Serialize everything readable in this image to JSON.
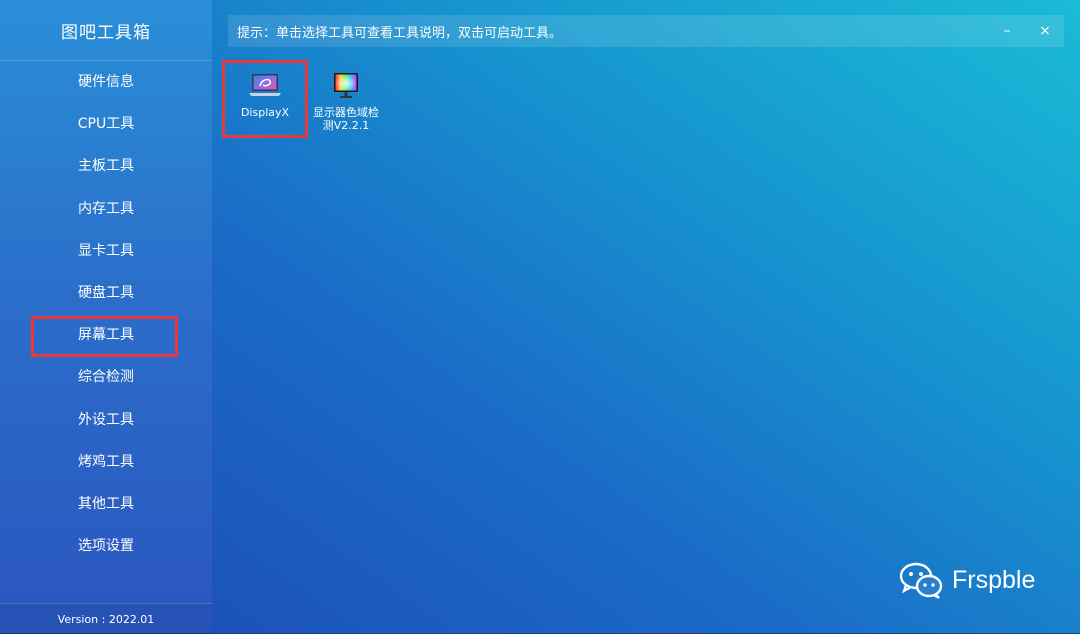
{
  "app": {
    "title": "图吧工具箱",
    "version": "Version : 2022.01"
  },
  "sidebar": {
    "items": [
      {
        "label": "硬件信息"
      },
      {
        "label": "CPU工具"
      },
      {
        "label": "主板工具"
      },
      {
        "label": "内存工具"
      },
      {
        "label": "显卡工具"
      },
      {
        "label": "硬盘工具"
      },
      {
        "label": "屏幕工具"
      },
      {
        "label": "综合检测"
      },
      {
        "label": "外设工具"
      },
      {
        "label": "烤鸡工具"
      },
      {
        "label": "其他工具"
      },
      {
        "label": "选项设置"
      }
    ]
  },
  "hint": {
    "text": "提示：单击选择工具可查看工具说明，双击可启动工具。"
  },
  "window": {
    "minimize": "–",
    "close": "×"
  },
  "tools": [
    {
      "label": "DisplayX",
      "icon": "laptop-display-icon"
    },
    {
      "label_line1": "显示器色域检",
      "label_line2": "测V2.2.1",
      "icon": "monitor-color-icon"
    }
  ],
  "watermark": {
    "text": "Frspble",
    "icon": "wechat-icon"
  },
  "colors": {
    "highlight": "#e8383c"
  }
}
